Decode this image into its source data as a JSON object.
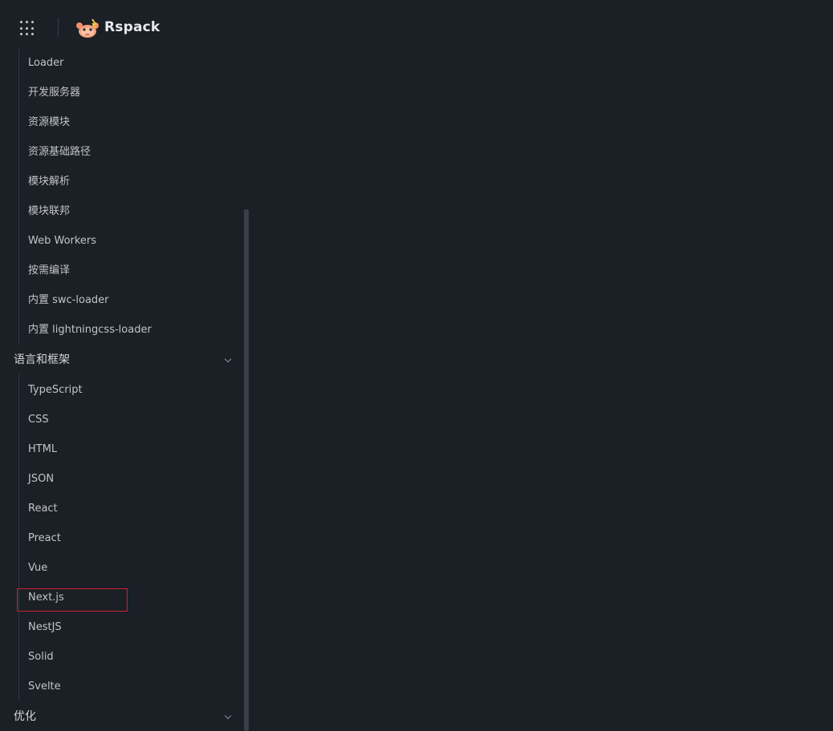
{
  "header": {
    "brand": "Rspack",
    "apps_icon": "grid-dots-icon",
    "logo_icon": "rspack-crab-logo"
  },
  "sidebar": {
    "items_a": [
      "Loader",
      "开发服务器",
      "资源模块",
      "资源基础路径",
      "模块解析",
      "模块联邦",
      "Web Workers",
      "按需编译",
      "内置 swc-loader",
      "内置 lightningcss-loader"
    ],
    "group_lang": "语言和框架",
    "items_b": [
      "TypeScript",
      "CSS",
      "HTML",
      "JSON",
      "React",
      "Preact",
      "Vue",
      "Next.js",
      "NestJS",
      "Solid",
      "Svelte"
    ],
    "group_opt": "优化"
  },
  "colors": {
    "background": "#1b1f26",
    "text": "#c1c4c9",
    "highlight": "#d01f35"
  }
}
